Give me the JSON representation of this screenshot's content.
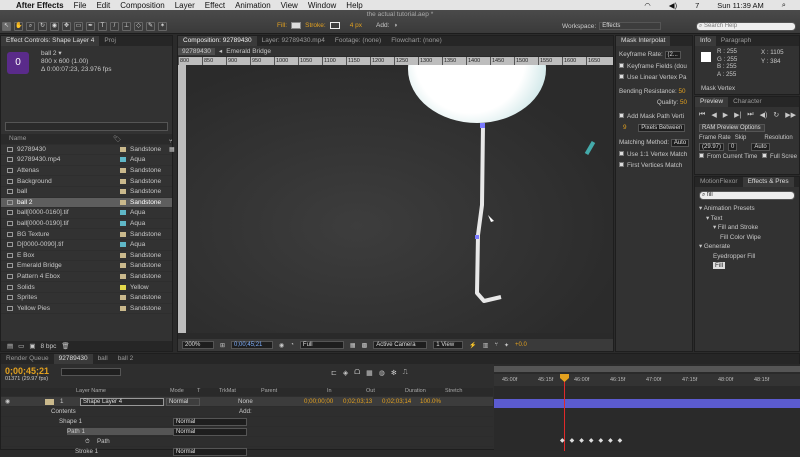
{
  "menubar": {
    "apple": "",
    "app": "After Effects",
    "items": [
      "File",
      "Edit",
      "Composition",
      "Layer",
      "Effect",
      "Animation",
      "View",
      "Window",
      "Help"
    ],
    "status": [
      "7",
      "Sun 11:39 AM"
    ]
  },
  "window": {
    "title": "the actual tutorial.aep *"
  },
  "toolbar": {
    "fill_label": "Fill:",
    "stroke_label": "Stroke:",
    "stroke_size": "4 px",
    "add_label": "Add:",
    "workspace_label": "Workspace:",
    "workspace_value": "Effects",
    "search_placeholder": "Search Help"
  },
  "project": {
    "tabs": [
      "Effect Controls: Shape Layer 4",
      "Proj"
    ],
    "selected_name": "ball 2 ▾",
    "selected_dims": "800 x 600 (1.00)",
    "selected_info": "Δ 0:00:07:23, 23.976 fps",
    "col_name": "Name",
    "bpc": "8 bpc",
    "items": [
      {
        "name": "92789430",
        "label": "Sandstone",
        "color": "#cab98c"
      },
      {
        "name": "92789430.mp4",
        "label": "Aqua",
        "color": "#5fb7c7"
      },
      {
        "name": "Attenas",
        "label": "Sandstone",
        "color": "#cab98c"
      },
      {
        "name": "Background",
        "label": "Sandstone",
        "color": "#cab98c"
      },
      {
        "name": "ball",
        "label": "Sandstone",
        "color": "#cab98c"
      },
      {
        "name": "ball 2",
        "label": "Sandstone",
        "color": "#cab98c"
      },
      {
        "name": "ball[0000-0160].tif",
        "label": "Aqua",
        "color": "#5fb7c7"
      },
      {
        "name": "ball[0000-0190].tif",
        "label": "Aqua",
        "color": "#5fb7c7"
      },
      {
        "name": "BG Texture",
        "label": "Sandstone",
        "color": "#cab98c"
      },
      {
        "name": "D[0000-0090].tif",
        "label": "Aqua",
        "color": "#5fb7c7"
      },
      {
        "name": "E Box",
        "label": "Sandstone",
        "color": "#cab98c"
      },
      {
        "name": "Emerald Bridge",
        "label": "Sandstone",
        "color": "#cab98c"
      },
      {
        "name": "Pattern 4 Ebox",
        "label": "Sandstone",
        "color": "#cab98c"
      },
      {
        "name": "Solids",
        "label": "Yellow",
        "color": "#e2d84a"
      },
      {
        "name": "Sprites",
        "label": "Sandstone",
        "color": "#cab98c"
      },
      {
        "name": "Yellow Pies",
        "label": "Sandstone",
        "color": "#cab98c"
      }
    ]
  },
  "comp": {
    "tabs": [
      "Composition: 92789430",
      "Layer: 92789430.mp4",
      "Footage: (none)",
      "Flowchart: (none)"
    ],
    "breadcrumb": [
      "92789430",
      "Emerald Bridge"
    ],
    "ruler_ticks": [
      "800",
      "850",
      "900",
      "950",
      "1000",
      "1050",
      "1100",
      "1150",
      "1200",
      "1250",
      "1300",
      "1350",
      "1400",
      "1450",
      "1500",
      "1550",
      "1600",
      "1650"
    ],
    "zoom": "200%",
    "timecode": "0;00;45;21",
    "resolution": "Full",
    "camera": "Active Camera",
    "view": "1 View",
    "exposure": "+0.0"
  },
  "mask": {
    "title": "Mask Interpolat",
    "keyframe_rate_label": "Keyframe Rate:",
    "keyframe_rate_value": "(2...",
    "keyframe_fields": "Keyframe Fields (dou",
    "linear_vertex": "Use Linear Vertex Pa",
    "bending_label": "Bending Resistance:",
    "bending_value": "50",
    "quality_label": "Quality:",
    "quality_value": "50",
    "add_mask_path": "Add Mask Path Verti",
    "vertex_count": "9",
    "pixels_between": "Pixels Between",
    "matching_label": "Matching Method:",
    "matching_value": "Auto",
    "one_to_one": "Use 1:1 Vertex Match",
    "first_vertices": "First Vertices Match"
  },
  "info": {
    "tabs": [
      "Info",
      "Paragraph"
    ],
    "r": "R : 255",
    "g": "G : 255",
    "b": "B : 255",
    "a": "A : 255",
    "x": "X : 1105",
    "y": "Y : 384",
    "mask_vertex": "Mask Vertex"
  },
  "preview": {
    "tabs": [
      "Preview",
      "Character"
    ],
    "ram_options": "RAM Preview Options",
    "frame_rate_label": "Frame Rate",
    "skip_label": "Skip",
    "resolution_label": "Resolution",
    "frame_rate_value": "(29.97)",
    "skip_value": "0",
    "resolution_value": "Auto",
    "from_current": "From Current Time",
    "full_screen": "Full Scree"
  },
  "effects": {
    "tabs": [
      "MotionFlexor",
      "Effects & Pres"
    ],
    "search_value": "fill",
    "tree": [
      {
        "text": "▾ Animation Presets",
        "indent": 0
      },
      {
        "text": "▾ Text",
        "indent": 1
      },
      {
        "text": "▾ Fill and Stroke",
        "indent": 2
      },
      {
        "text": "Fill Color Wipe",
        "indent": 3
      },
      {
        "text": "▾ Generate",
        "indent": 0
      },
      {
        "text": "Eyedropper Fill",
        "indent": 2
      },
      {
        "text": "Fill",
        "indent": 2
      }
    ]
  },
  "timeline": {
    "tabs": [
      "Render Queue",
      "92789430",
      "ball",
      "ball 2"
    ],
    "timecode": "0;00;45;21",
    "fps": "01371 (29.97 fps)",
    "headers": [
      "Layer Name",
      "Mode",
      "T",
      "TrkMat",
      "Parent",
      "In",
      "Out",
      "Duration",
      "Stretch"
    ],
    "ruler": [
      "45:00f",
      "45:15f",
      "46:00f",
      "46:15f",
      "47:00f",
      "47:15f",
      "48:00f",
      "48:15f"
    ],
    "layer": {
      "num": "1",
      "name": "Shape Layer 4",
      "mode": "Normal",
      "parent": "None",
      "in": "0;00;00;00",
      "out": "0;02;03;13",
      "duration": "0;02;03;14",
      "stretch": "100.0%"
    },
    "contents": "Contents",
    "add": "Add:",
    "shape": "Shape 1",
    "shape_mode": "Normal",
    "path": "Path 1",
    "path_mode": "Normal",
    "path_prop": "Path",
    "stroke": "Stroke 1",
    "stroke_mode": "Normal"
  },
  "colors": {
    "accent": "#e3a11f",
    "selection": "#5e5e5e",
    "layer_bar": "#5b5bcf",
    "path": "#dcdcdc"
  }
}
